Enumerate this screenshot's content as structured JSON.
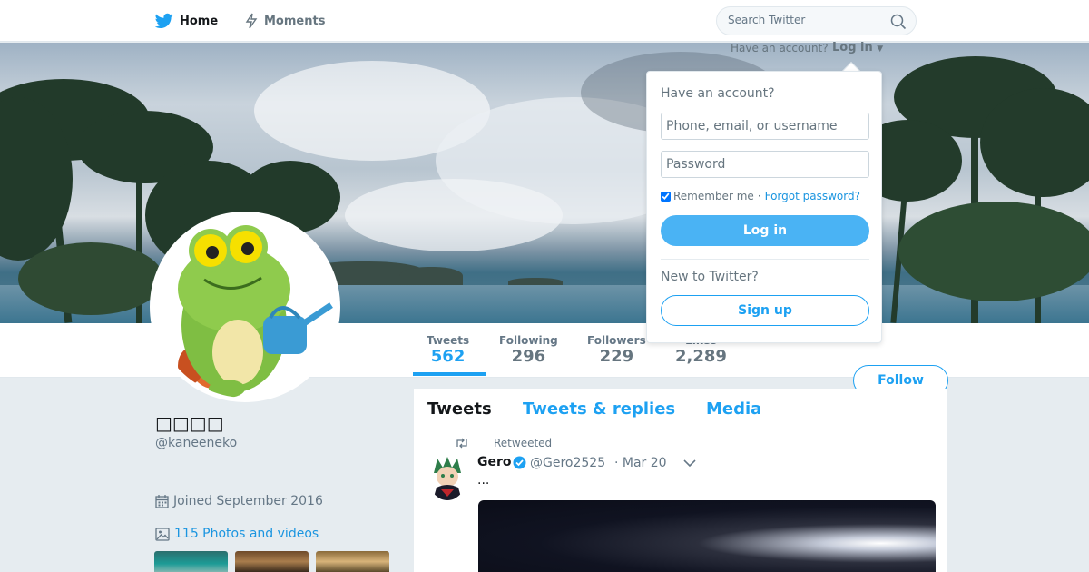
{
  "nav": {
    "home_label": "Home",
    "moments_label": "Moments",
    "search_placeholder": "Search Twitter"
  },
  "login_bar": {
    "have_account": "Have an account?",
    "login_label": "Log in"
  },
  "login_dropdown": {
    "title": "Have an account?",
    "username_placeholder": "Phone, email, or username",
    "password_placeholder": "Password",
    "remember_label": "Remember me",
    "separator": "·",
    "forgot_label": "Forgot password?",
    "login_button": "Log in",
    "new_label": "New to Twitter?",
    "signup_button": "Sign up"
  },
  "profile": {
    "name": "□□□□",
    "handle": "@kaneeneko",
    "joined": "Joined September 2016",
    "photos_label": "115 Photos and videos",
    "follow_button": "Follow"
  },
  "stats": [
    {
      "label": "Tweets",
      "value": "562"
    },
    {
      "label": "Following",
      "value": "296"
    },
    {
      "label": "Followers",
      "value": "229"
    },
    {
      "label": "Likes",
      "value": "2,289"
    }
  ],
  "tabs": [
    {
      "label": "Tweets"
    },
    {
      "label": "Tweets & replies"
    },
    {
      "label": "Media"
    }
  ],
  "tweet": {
    "retweet_label": "Retweeted",
    "author_name": "Gero",
    "author_handle": "@Gero2525",
    "date": "· Mar 20",
    "text": "..."
  },
  "colors": {
    "accent": "#1da1f2",
    "background": "#e6ecf0"
  },
  "icons": {
    "nav_home": "twitter-bird-icon",
    "nav_moments": "lightning-icon",
    "search": "magnifier-icon",
    "calendar": "calendar-icon",
    "photos": "image-icon",
    "retweet": "retweet-icon",
    "verified": "verified-badge-icon",
    "caret": "chevron-down-icon"
  }
}
